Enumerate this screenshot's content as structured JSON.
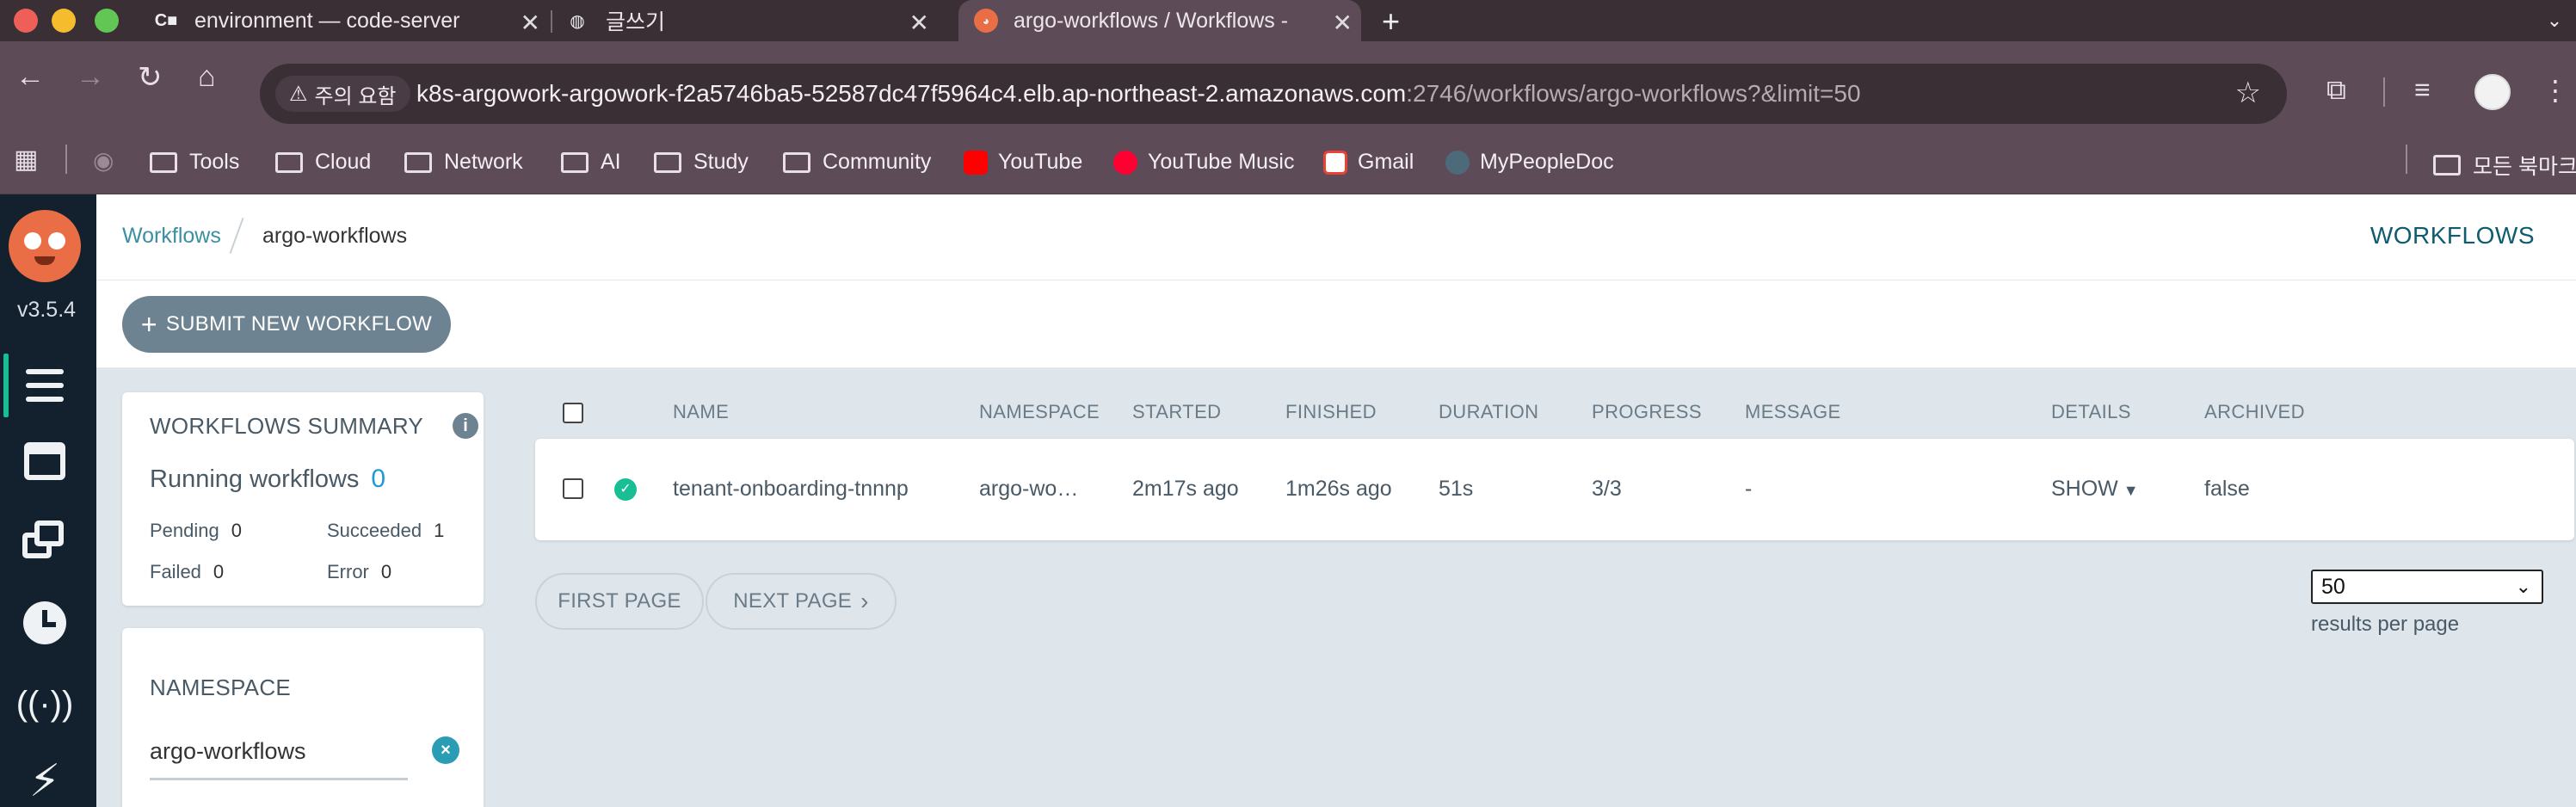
{
  "browser": {
    "tabs": [
      {
        "title": "environment — code-server",
        "icon": "code-server-icon"
      },
      {
        "title": "글쓰기",
        "icon": "globe-icon"
      },
      {
        "title": "argo-workflows / Workflows -",
        "icon": "argo-icon"
      }
    ],
    "security_label": "주의 요함",
    "url_host": "k8s-argowork-argowork-f2a5746ba5-52587dc47f5964c4.elb.ap-northeast-2.amazonaws.com",
    "url_rest": ":2746/workflows/argo-workflows?&limit=50",
    "bookmarks": [
      {
        "label": "Tools",
        "type": "folder"
      },
      {
        "label": "Cloud",
        "type": "folder"
      },
      {
        "label": "Network",
        "type": "folder"
      },
      {
        "label": "AI",
        "type": "folder"
      },
      {
        "label": "Study",
        "type": "folder"
      },
      {
        "label": "Community",
        "type": "folder"
      },
      {
        "label": "YouTube",
        "type": "site",
        "color": "#ff0000"
      },
      {
        "label": "YouTube Music",
        "type": "site",
        "color": "#ff0033"
      },
      {
        "label": "Gmail",
        "type": "site",
        "color": "#ea4335"
      },
      {
        "label": "MyPeopleDoc",
        "type": "site",
        "color": "#4d6a7a"
      }
    ],
    "all_bookmarks": "모든 북마크"
  },
  "app": {
    "version": "v3.5.4",
    "breadcrumb": {
      "parent": "Workflows",
      "current": "argo-workflows"
    },
    "page_title": "WORKFLOWS",
    "submit_label": "SUBMIT NEW WORKFLOW",
    "summary": {
      "title": "WORKFLOWS SUMMARY",
      "running_label": "Running workflows",
      "running_count": "0",
      "pending_label": "Pending",
      "pending": "0",
      "succeeded_label": "Succeeded",
      "succeeded": "1",
      "failed_label": "Failed",
      "failed": "0",
      "error_label": "Error",
      "error": "0"
    },
    "namespace": {
      "title": "NAMESPACE",
      "value": "argo-workflows"
    },
    "columns": [
      "NAME",
      "NAMESPACE",
      "STARTED",
      "FINISHED",
      "DURATION",
      "PROGRESS",
      "MESSAGE",
      "DETAILS",
      "ARCHIVED"
    ],
    "rows": [
      {
        "status": "succeeded",
        "name": "tenant-onboarding-tnnnp",
        "namespace": "argo-wo…",
        "started": "2m17s ago",
        "finished": "1m26s ago",
        "duration": "51s",
        "progress": "3/3",
        "message": "-",
        "details": "SHOW",
        "archived": "false"
      }
    ],
    "pager": {
      "first": "FIRST PAGE",
      "next": "NEXT PAGE"
    },
    "per_page": {
      "value": "50",
      "label": "results per page"
    },
    "accent": "#18be94",
    "link_color": "#3a8fa3"
  }
}
